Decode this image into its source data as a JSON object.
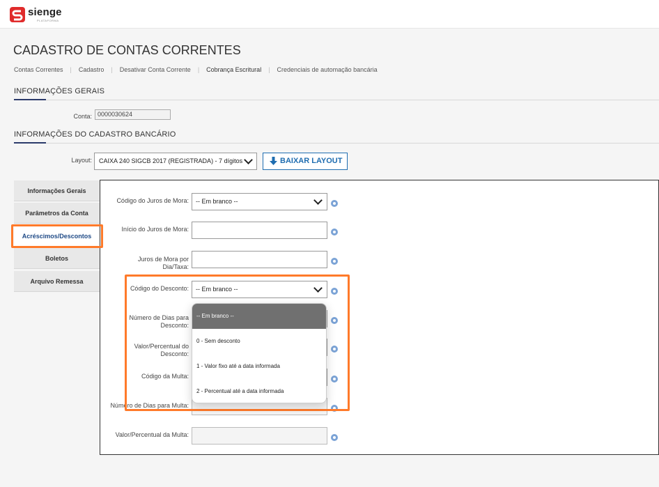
{
  "app": {
    "name": "sienge",
    "sub": "PLATAFORMA"
  },
  "page": {
    "title": "CADASTRO DE CONTAS CORRENTES"
  },
  "breadcrumb": [
    "Contas Correntes",
    "Cadastro",
    "Desativar Conta Corrente",
    "Cobrança Escritural",
    "Credenciais de automação bancária"
  ],
  "sections": {
    "general": "INFORMAÇÕES GERAIS",
    "bank": "INFORMAÇÕES DO CADASTRO BANCÁRIO"
  },
  "conta": {
    "label": "Conta:",
    "value": "0000030624"
  },
  "layout": {
    "label": "Layout:",
    "value": "CAIXA 240 SIGCB 2017 (REGISTRADA) - 7 dígitos",
    "button": "BAIXAR LAYOUT"
  },
  "tabs": [
    "Informações Gerais",
    "Parâmetros da Conta",
    "Acréscimos/Descontos",
    "Boletos",
    "Arquivo Remessa"
  ],
  "form": {
    "juros_codigo_label": "Código do Juros de Mora:",
    "juros_codigo_value": "-- Em branco --",
    "juros_inicio_label": "Início do Juros de Mora:",
    "juros_taxa_label_1": "Juros de Mora por",
    "juros_taxa_label_2": "Dia/Taxa:",
    "desconto_codigo_label": "Código do Desconto:",
    "desconto_codigo_value": "-- Em branco --",
    "desconto_dias_label_1": "Número de Dias para",
    "desconto_dias_label_2": "Desconto:",
    "desconto_valor_label_1": "Valor/Percentual do",
    "desconto_valor_label_2": "Desconto:",
    "multa_codigo_label": "Código da Multa:",
    "multa_dias_label": "Número de Dias para Multa:",
    "multa_valor_label": "Valor/Percentual da Multa:"
  },
  "dropdown_options": [
    "-- Em branco --",
    "0 - Sem desconto",
    "1 - Valor fixo até a data informada",
    "2 - Percentual até a data informada"
  ],
  "colors": {
    "highlight": "#ff7a2a",
    "brand_red": "#e02b2b",
    "accent_blue": "#1f6db0"
  }
}
